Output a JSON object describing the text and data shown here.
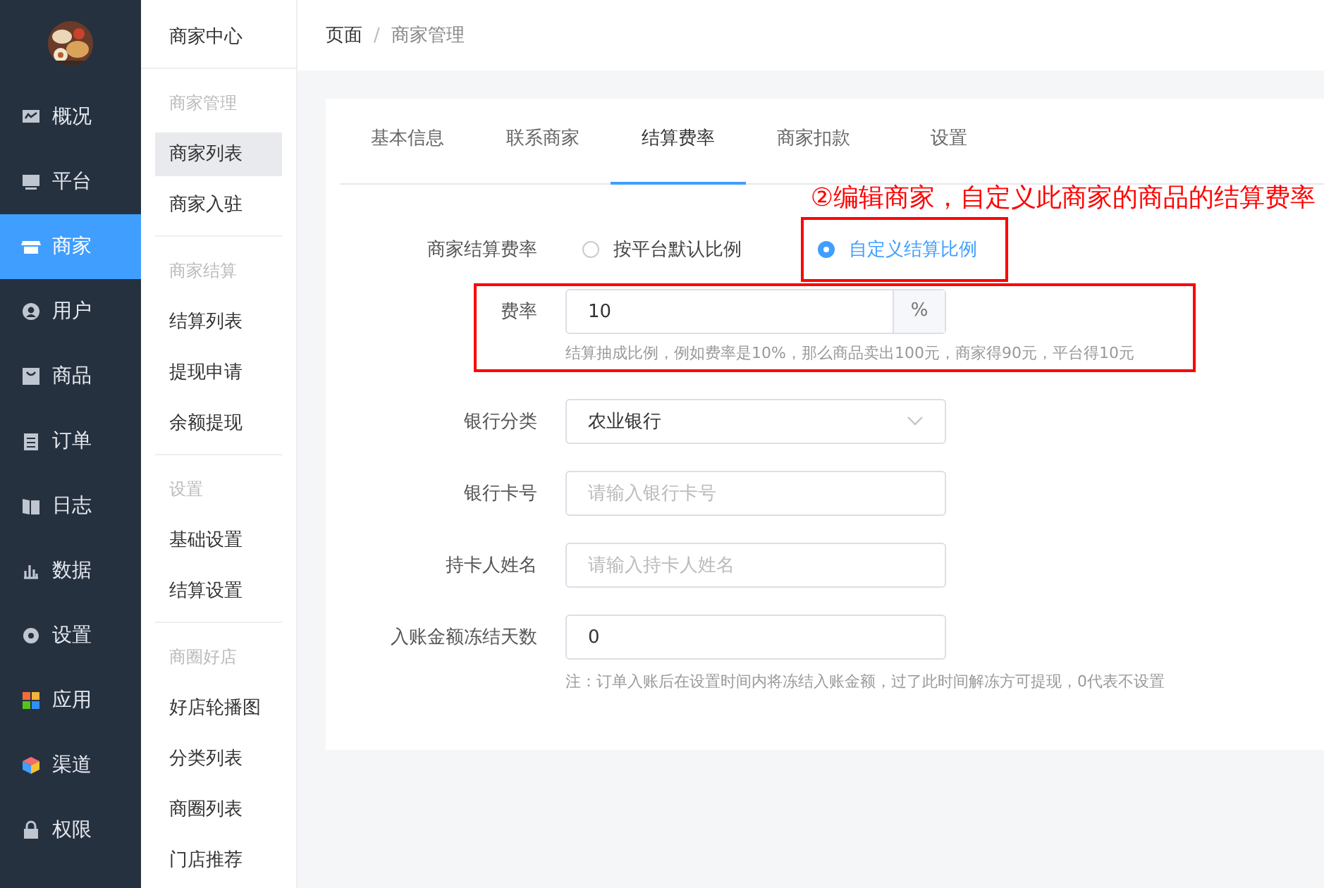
{
  "sidebar": {
    "items": [
      {
        "label": "概况",
        "selected": false
      },
      {
        "label": "平台",
        "selected": false
      },
      {
        "label": "商家",
        "selected": true
      },
      {
        "label": "用户",
        "selected": false
      },
      {
        "label": "商品",
        "selected": false
      },
      {
        "label": "订单",
        "selected": false
      },
      {
        "label": "日志",
        "selected": false
      },
      {
        "label": "数据",
        "selected": false
      },
      {
        "label": "设置",
        "selected": false
      },
      {
        "label": "应用",
        "selected": false
      },
      {
        "label": "渠道",
        "selected": false
      },
      {
        "label": "权限",
        "selected": false
      }
    ]
  },
  "subnav": {
    "title": "商家中心",
    "groups": [
      {
        "title": "商家管理",
        "items": [
          {
            "label": "商家列表",
            "selected": true
          },
          {
            "label": "商家入驻",
            "selected": false
          }
        ]
      },
      {
        "title": "商家结算",
        "items": [
          {
            "label": "结算列表",
            "selected": false
          },
          {
            "label": "提现申请",
            "selected": false
          },
          {
            "label": "余额提现",
            "selected": false
          }
        ]
      },
      {
        "title": "设置",
        "items": [
          {
            "label": "基础设置",
            "selected": false
          },
          {
            "label": "结算设置",
            "selected": false
          }
        ]
      },
      {
        "title": "商圈好店",
        "items": [
          {
            "label": "好店轮播图",
            "selected": false
          },
          {
            "label": "分类列表",
            "selected": false
          },
          {
            "label": "商圈列表",
            "selected": false
          },
          {
            "label": "门店推荐",
            "selected": false
          }
        ]
      }
    ]
  },
  "breadcrumb": {
    "separator": "/",
    "items": [
      "页面",
      "商家管理"
    ]
  },
  "tabs": [
    {
      "label": "基本信息",
      "selected": false
    },
    {
      "label": "联系商家",
      "selected": false
    },
    {
      "label": "结算费率",
      "selected": true
    },
    {
      "label": "商家扣款",
      "selected": false
    },
    {
      "label": "设置",
      "selected": false
    }
  ],
  "annotation": "②编辑商家，自定义此商家的商品的结算费率",
  "form": {
    "rate_mode": {
      "label": "商家结算费率",
      "options": [
        {
          "label": "按平台默认比例",
          "selected": false,
          "highlight": false
        },
        {
          "label": "自定义结算比例",
          "selected": true,
          "highlight": true
        }
      ]
    },
    "rate": {
      "label": "费率",
      "value": "10",
      "suffix": "%",
      "hint": "结算抽成比例，例如费率是10%，那么商品卖出100元，商家得90元，平台得10元",
      "highlight": true
    },
    "fields": [
      {
        "kind": "select",
        "label": "银行分类",
        "value": "农业银行"
      },
      {
        "kind": "input",
        "label": "银行卡号",
        "placeholder": "请输入银行卡号"
      },
      {
        "kind": "input",
        "label": "持卡人姓名",
        "placeholder": "请输入持卡人姓名"
      },
      {
        "kind": "input",
        "label": "入账金额冻结天数",
        "value": "0",
        "hint": "注：订单入账后在设置时间内将冻结入账金额，过了此时间解冻方可提现，0代表不设置"
      }
    ]
  }
}
